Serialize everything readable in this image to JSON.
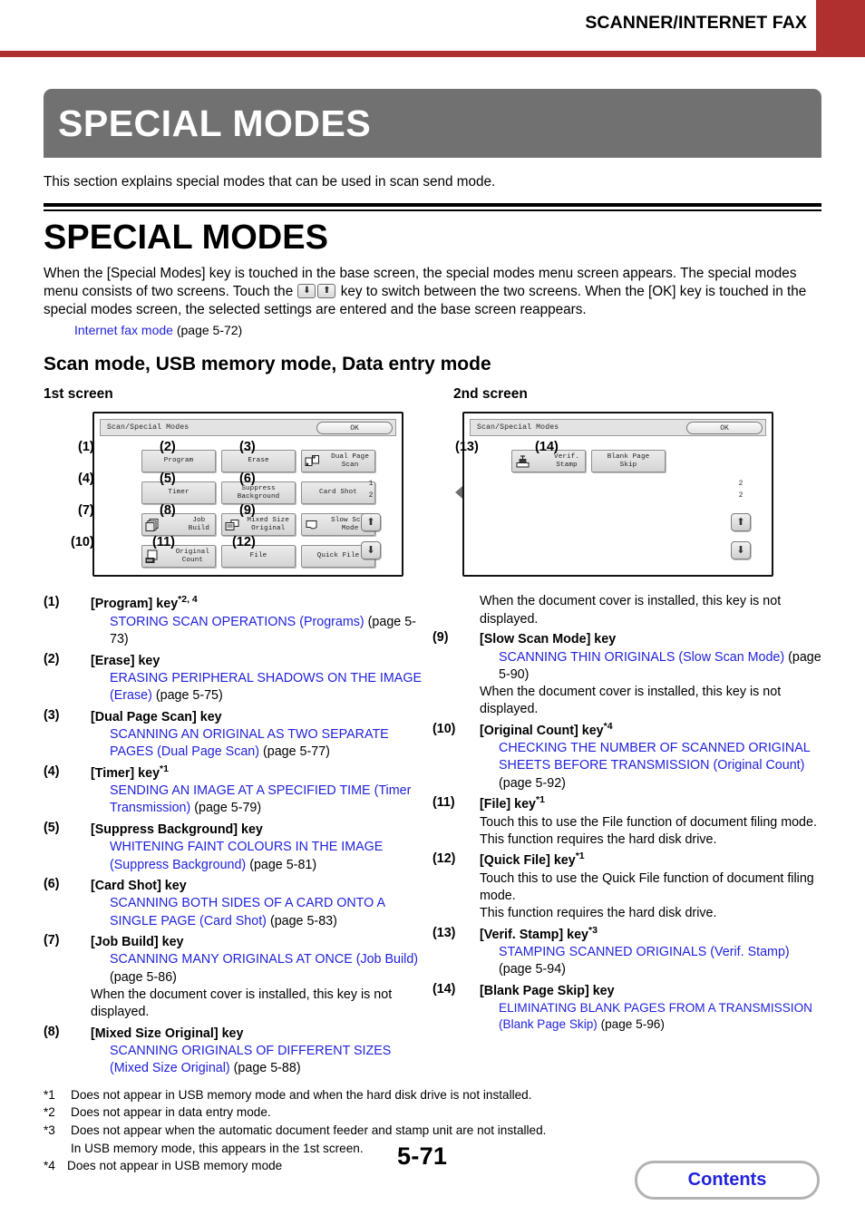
{
  "header": {
    "running_title": "SCANNER/INTERNET FAX",
    "accent_color": "#b03030"
  },
  "banner": {
    "title": "SPECIAL MODES",
    "background_color": "#717171"
  },
  "intro_line": "This section explains special modes that can be used in scan send mode.",
  "section": {
    "heading": "SPECIAL MODES",
    "paragraph_part1": "When the [Special Modes] key is touched in the base screen, the special modes menu screen appears. The special modes menu consists of two screens. Touch the ",
    "paragraph_part2": " key to switch between the two screens. When the [OK] key is touched in the special modes screen, the selected settings are entered and the base screen reappears.",
    "link_text": "Internet fax mode",
    "link_page": "(page 5-72)",
    "subheading": "Scan mode, USB memory mode, Data entry mode"
  },
  "screens": {
    "first_label": "1st screen",
    "second_label": "2nd screen",
    "panel_title": "Scan/Special Modes",
    "ok_label": "OK",
    "first": {
      "page_top": "1",
      "page_bottom": "2",
      "keys": [
        {
          "num": "(1)",
          "label": "Program",
          "icon": "none"
        },
        {
          "num": "(2)",
          "label": "Erase",
          "icon": "none"
        },
        {
          "num": "(3)",
          "label": "Dual Page\nScan",
          "icon": "dual-page-scan-icon"
        },
        {
          "num": "(4)",
          "label": "Timer",
          "icon": "none"
        },
        {
          "num": "(5)",
          "label": "Suppress\nBackground",
          "icon": "none"
        },
        {
          "num": "(6)",
          "label": "Card Shot",
          "icon": "none"
        },
        {
          "num": "(7)",
          "label": "Job\nBuild",
          "icon": "job-build-icon"
        },
        {
          "num": "(8)",
          "label": "Mixed Size\nOriginal",
          "icon": "mixed-size-original-icon"
        },
        {
          "num": "(9)",
          "label": "Slow Scan\nMode",
          "icon": "slow-scan-mode-icon"
        },
        {
          "num": "(10)",
          "label": "Original\nCount",
          "icon": "original-count-icon"
        },
        {
          "num": "(11)",
          "label": "File",
          "icon": "none"
        },
        {
          "num": "(12)",
          "label": "Quick File",
          "icon": "none"
        }
      ]
    },
    "second": {
      "page_top": "2",
      "page_bottom": "2",
      "keys": [
        {
          "num": "(13)",
          "label": "Verif.\nStamp",
          "icon": "verif-stamp-icon"
        },
        {
          "num": "(14)",
          "label": "Blank Page\nSkip",
          "icon": "none"
        }
      ]
    },
    "swap_arrow": "double-arrow-horizontal-icon"
  },
  "list_left": [
    {
      "num": "(1)",
      "title": "[Program] key",
      "sup": "*2, 4",
      "link": "STORING SCAN OPERATIONS (Programs)",
      "page": "(page 5-73)",
      "note": ""
    },
    {
      "num": "(2)",
      "title": "[Erase] key",
      "sup": "",
      "link": "ERASING PERIPHERAL SHADOWS ON THE IMAGE (Erase)",
      "page": "(page 5-75)",
      "note": ""
    },
    {
      "num": "(3)",
      "title": "[Dual Page Scan] key",
      "sup": "",
      "link": "SCANNING AN ORIGINAL AS TWO SEPARATE PAGES (Dual Page Scan)",
      "page": "(page 5-77)",
      "note": ""
    },
    {
      "num": "(4)",
      "title": "[Timer] key",
      "sup": "*1",
      "link": "SENDING AN IMAGE AT A SPECIFIED TIME (Timer Transmission)",
      "page": "(page 5-79)",
      "note": ""
    },
    {
      "num": "(5)",
      "title": "[Suppress Background] key",
      "sup": "",
      "link": "WHITENING FAINT COLOURS IN THE IMAGE (Suppress Background)",
      "page": "(page 5-81)",
      "note": ""
    },
    {
      "num": "(6)",
      "title": "[Card Shot] key",
      "sup": "",
      "link": "SCANNING BOTH SIDES OF A CARD ONTO A SINGLE PAGE (Card Shot)",
      "page": "(page 5-83)",
      "note": ""
    },
    {
      "num": "(7)",
      "title": "[Job Build] key",
      "sup": "",
      "link": "SCANNING MANY ORIGINALS AT ONCE (Job Build)",
      "page": "(page 5-86)",
      "note": "When the document cover is installed, this key is not displayed."
    },
    {
      "num": "(8)",
      "title": "[Mixed Size Original] key",
      "sup": "",
      "link": "SCANNING ORIGINALS OF DIFFERENT SIZES (Mixed Size Original)",
      "page": "(page 5-88)",
      "note": ""
    }
  ],
  "list_right_pre_note": "When the document cover is installed, this key is not displayed.",
  "list_right": [
    {
      "num": "(9)",
      "title": "[Slow Scan Mode] key",
      "sup": "",
      "link": "SCANNING THIN ORIGINALS (Slow Scan Mode)",
      "page": "(page 5-90)",
      "note": "When the document cover is installed, this key is not displayed."
    },
    {
      "num": "(10)",
      "title": "[Original Count] key",
      "sup": "*4",
      "link": "CHECKING THE NUMBER OF SCANNED ORIGINAL SHEETS BEFORE TRANSMISSION (Original Count)",
      "page": "(page 5-92)",
      "note": ""
    },
    {
      "num": "(11)",
      "title": "[File] key",
      "sup": "*1",
      "link": "",
      "page": "",
      "note": "Touch this to use the File function of document filing mode. This function requires the hard disk drive."
    },
    {
      "num": "(12)",
      "title": "[Quick File] key",
      "sup": "*1",
      "link": "",
      "page": "",
      "note": "Touch this to use the Quick File function of document filing mode.\nThis function requires the hard disk drive."
    },
    {
      "num": "(13)",
      "title": "[Verif. Stamp] key",
      "sup": "*3",
      "link": "STAMPING SCANNED ORIGINALS (Verif. Stamp)",
      "page": "(page 5-94)",
      "note": ""
    },
    {
      "num": "(14)",
      "title": "[Blank Page Skip] key",
      "sup": "",
      "link": "ELIMINATING BLANK PAGES FROM A TRANSMISSION (Blank Page Skip)",
      "page": "(page 5-96)",
      "note": ""
    }
  ],
  "footnotes": [
    {
      "mark": "*1",
      "text": "Does not appear in USB memory mode and when the hard disk drive is not installed.",
      "cont": ""
    },
    {
      "mark": "*2",
      "text": "Does not appear in data entry mode.",
      "cont": ""
    },
    {
      "mark": "*3",
      "text": "Does not appear when the automatic document feeder and stamp unit are not installed.",
      "cont": "In USB memory mode, this appears in the 1st screen."
    },
    {
      "mark": "*4",
      "text": "Does not appear in USB memory mode",
      "cont": ""
    }
  ],
  "footer": {
    "page_number": "5-71",
    "contents_label": "Contents",
    "contents_color": "#2222dd"
  }
}
